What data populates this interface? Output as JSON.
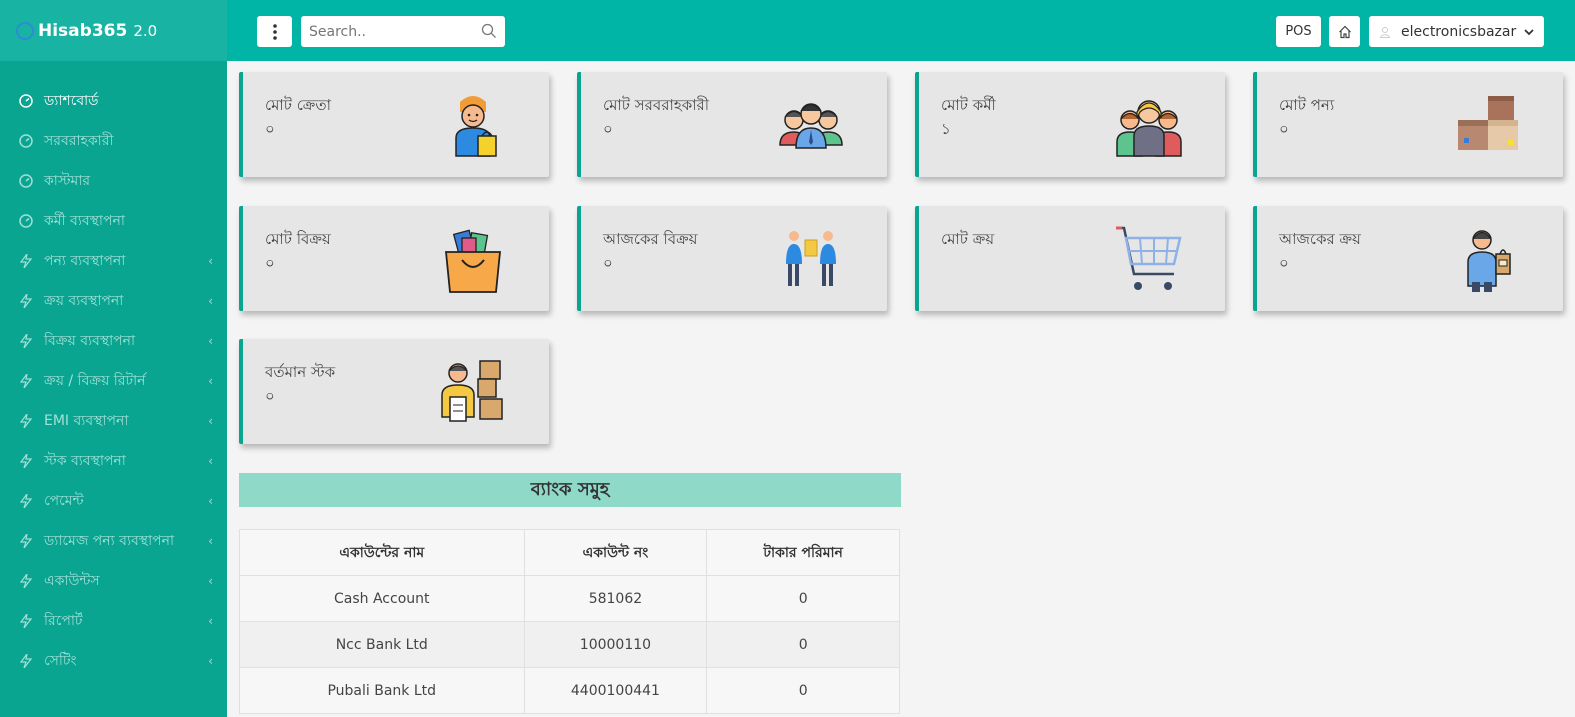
{
  "brand": {
    "name": "Hisab365",
    "version": "2.0"
  },
  "header": {
    "search_placeholder": "Search..",
    "pos_label": "POS",
    "username": "electronicsbazar"
  },
  "sidebar": {
    "items": [
      {
        "label": "ড্যাশবোর্ড",
        "icon": "dashboard-icon",
        "has_submenu": false
      },
      {
        "label": "সরবরাহকারী",
        "icon": "dashboard-icon",
        "has_submenu": false
      },
      {
        "label": "কাস্টমার",
        "icon": "dashboard-icon",
        "has_submenu": false
      },
      {
        "label": "কর্মী ব্যবস্থাপনা",
        "icon": "dashboard-icon",
        "has_submenu": false
      },
      {
        "label": "পন্য ব্যবস্থাপনা",
        "icon": "bolt-icon",
        "has_submenu": true
      },
      {
        "label": "ক্রয় ব্যবস্থাপনা",
        "icon": "bolt-icon",
        "has_submenu": true
      },
      {
        "label": "বিক্রয় ব্যবস্থাপনা",
        "icon": "bolt-icon",
        "has_submenu": true
      },
      {
        "label": "ক্রয় / বিক্রয় রিটার্ন",
        "icon": "bolt-icon",
        "has_submenu": true
      },
      {
        "label": "EMI ব্যবস্থাপনা",
        "icon": "bolt-icon",
        "has_submenu": true
      },
      {
        "label": "স্টক ব্যবস্থাপনা",
        "icon": "bolt-icon",
        "has_submenu": true
      },
      {
        "label": "পেমেন্ট",
        "icon": "bolt-icon",
        "has_submenu": true
      },
      {
        "label": "ড্যামেজ পন্য ব্যবস্থাপনা",
        "icon": "bolt-icon",
        "has_submenu": true
      },
      {
        "label": "একাউন্টস",
        "icon": "bolt-icon",
        "has_submenu": true
      },
      {
        "label": "রিপোর্ট",
        "icon": "bolt-icon",
        "has_submenu": true
      },
      {
        "label": "সেটিং",
        "icon": "bolt-icon",
        "has_submenu": true
      }
    ]
  },
  "cards": [
    {
      "title": "মোট ক্রেতা",
      "value": "০",
      "icon": "customer-icon"
    },
    {
      "title": "মোট সরবরাহকারী",
      "value": "০",
      "icon": "suppliers-icon"
    },
    {
      "title": "মোট কর্মী",
      "value": "১",
      "icon": "employees-icon"
    },
    {
      "title": "মোট পন্য",
      "value": "০",
      "icon": "boxes-icon"
    },
    {
      "title": "মোট বিক্রয়",
      "value": "০",
      "icon": "shopping-bag-icon"
    },
    {
      "title": "আজকের বিক্রয়",
      "value": "০",
      "icon": "handover-icon"
    },
    {
      "title": "মোট ক্রয়",
      "value": "",
      "icon": "cart-icon"
    },
    {
      "title": "আজকের ক্রয়",
      "value": "০",
      "icon": "shopper-icon"
    },
    {
      "title": "বর্তমান স্টক",
      "value": "০",
      "icon": "stock-worker-icon"
    }
  ],
  "bank": {
    "title": "ব্যাংক সমুহ",
    "columns": [
      "একাউন্টের নাম",
      "একাউন্ট নং",
      "টাকার পরিমান"
    ],
    "rows": [
      [
        "Cash Account",
        "581062",
        "0"
      ],
      [
        "Ncc Bank Ltd",
        "10000110",
        "0"
      ],
      [
        "Pubali Bank Ltd",
        "4400100441",
        "0"
      ]
    ]
  },
  "colors": {
    "sidebar": "#0aa590",
    "header": "#00b5a5",
    "accent": "#8fd9c9"
  }
}
